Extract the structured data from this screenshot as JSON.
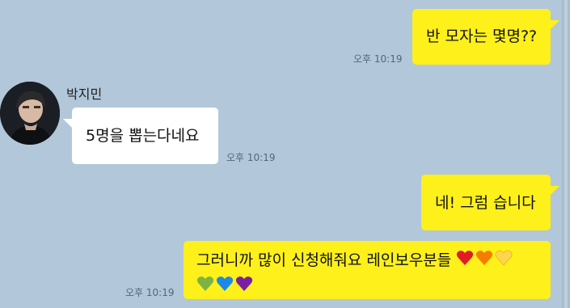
{
  "messages": [
    {
      "side": "me",
      "text": "반 모자는 몇명??",
      "time": "오후 10:19"
    },
    {
      "side": "other",
      "sender": "박지민",
      "text": "5명을 뽑는다네요",
      "time": "오후 10:19"
    },
    {
      "side": "me",
      "text": "네! 그럼 습니다",
      "time": ""
    },
    {
      "side": "me",
      "text": "그러니까 많이 신청해줘요 레인보우분들",
      "time": "오후 10:19",
      "emoji": [
        "red-heart",
        "orange-heart",
        "yellow-heart",
        "green-heart",
        "blue-heart",
        "purple-heart"
      ]
    }
  ],
  "colors": {
    "background": "#b2c7d9",
    "my_bubble": "#fef01b",
    "other_bubble": "#ffffff",
    "hearts": [
      "#e01b24",
      "#f57c00",
      "#ffd54f",
      "#7cb342",
      "#1e88e5",
      "#7b1fa2"
    ]
  }
}
